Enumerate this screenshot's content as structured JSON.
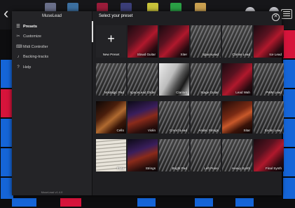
{
  "app": {
    "back_glyph": "‹",
    "menu_icon": "hamburger-icon"
  },
  "panel": {
    "title": "MuseLead",
    "content_title": "Select your preset",
    "close_glyph": "✕",
    "version": "MuseLead v1.4.0"
  },
  "sidebar": {
    "items": [
      {
        "label": "Presets",
        "icon": "☰",
        "active": true
      },
      {
        "label": "Customize",
        "icon": "✂",
        "active": false
      },
      {
        "label": "Midi Controller",
        "icon": "⌨",
        "active": false
      },
      {
        "label": "Backing-tracks",
        "icon": "♪",
        "active": false
      },
      {
        "label": "Help",
        "icon": "?",
        "active": false
      }
    ]
  },
  "presets": [
    {
      "label": "New Preset",
      "art": "new"
    },
    {
      "label": "Slowd Guitar",
      "art": "guitar"
    },
    {
      "label": "Xiter",
      "art": "guitar"
    },
    {
      "label": "SpaceLead",
      "art": "keys"
    },
    {
      "label": "Chinse Lead",
      "art": "keys"
    },
    {
      "label": "Ice Lead",
      "art": "guitar"
    },
    {
      "label": "Nostalgic Pad",
      "art": "keys"
    },
    {
      "label": "SpaceLead Glider",
      "art": "keys"
    },
    {
      "label": "Clarinet",
      "art": "clarinet"
    },
    {
      "label": "Stage Guitar",
      "art": "keys"
    },
    {
      "label": "Lead Wah",
      "art": "guitar"
    },
    {
      "label": "PWM Lead",
      "art": "keys"
    },
    {
      "label": "Cello",
      "art": "cello"
    },
    {
      "label": "Violin",
      "art": "violin"
    },
    {
      "label": "CrunchLead",
      "art": "keys"
    },
    {
      "label": "Arabic Strings",
      "art": "keys"
    },
    {
      "label": "Sitar",
      "art": "strings"
    },
    {
      "label": "Exotic Lead",
      "art": "keys"
    },
    {
      "label": "Flute",
      "art": "sheet"
    },
    {
      "label": "Strings",
      "art": "violin"
    },
    {
      "label": "Bright Pad",
      "art": "keys"
    },
    {
      "label": "Left Piano",
      "art": "keys"
    },
    {
      "label": "Heavy Synth",
      "art": "keys"
    },
    {
      "label": "Final Synth",
      "art": "guitar"
    }
  ],
  "colors": {
    "pad_blue": "#1565d8",
    "pad_red": "#d6143b",
    "panel_bg": "#1f1f22"
  }
}
